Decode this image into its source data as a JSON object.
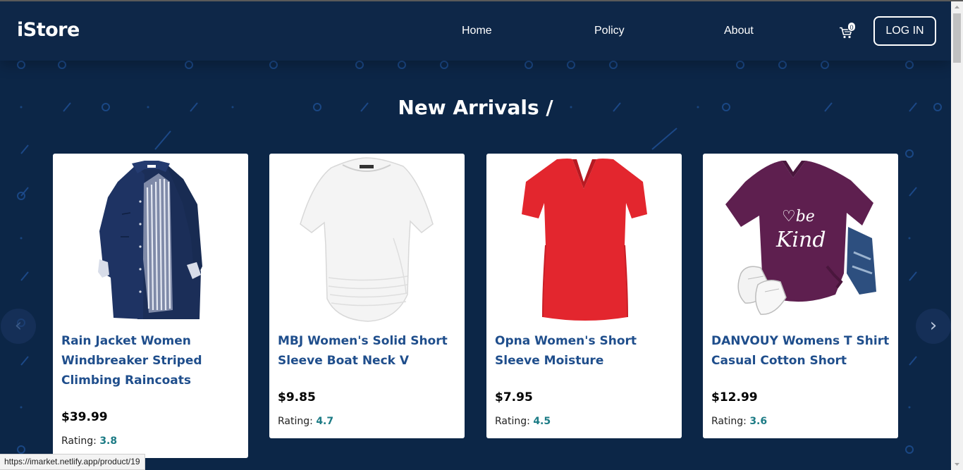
{
  "header": {
    "brand": "iStore",
    "nav": {
      "home": "Home",
      "policy": "Policy",
      "about": "About"
    },
    "cart_count": "0",
    "login_label": "LOG IN"
  },
  "section": {
    "title": "New Arrivals /"
  },
  "products": [
    {
      "title": "Rain Jacket Women Windbreaker Striped Climbing Raincoats",
      "price": "$39.99",
      "rating_label": "Rating:",
      "rating": "3.8"
    },
    {
      "title": "MBJ Women's Solid Short Sleeve Boat Neck V",
      "price": "$9.85",
      "rating_label": "Rating:",
      "rating": "4.7"
    },
    {
      "title": "Opna Women's Short Sleeve Moisture",
      "price": "$7.95",
      "rating_label": "Rating:",
      "rating": "4.5"
    },
    {
      "title": "DANVOUY Womens T Shirt Casual Cotton Short",
      "price": "$12.99",
      "rating_label": "Rating:",
      "rating": "3.6"
    }
  ],
  "carousel": {
    "prev_icon": "‹",
    "next_icon": "›"
  },
  "status_bar": {
    "url": "https://imarket.netlify.app/product/19"
  },
  "colors": {
    "background": "#0c2647",
    "navbar": "#0e2748",
    "title_blue": "#1f4e8c",
    "rating_teal": "#1c7b85"
  },
  "icons": [
    "cart-icon",
    "chevron-left-icon",
    "chevron-right-icon"
  ]
}
